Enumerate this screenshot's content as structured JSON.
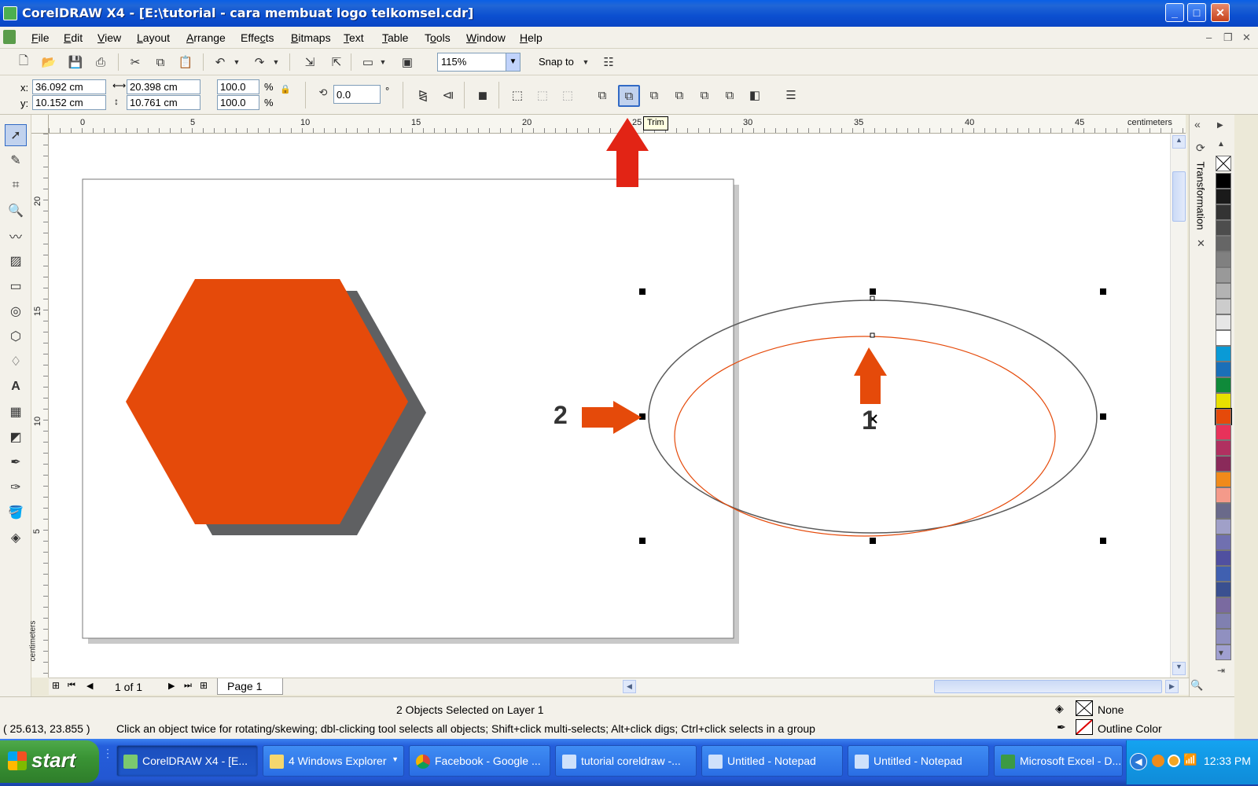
{
  "window": {
    "title": "CorelDRAW X4 - [E:\\tutorial - cara membuat logo telkomsel.cdr]",
    "btn_minimize": "_",
    "btn_maximize": "□",
    "btn_close": "✕"
  },
  "menu": [
    "File",
    "Edit",
    "View",
    "Layout",
    "Arrange",
    "Effects",
    "Bitmaps",
    "Text",
    "Table",
    "Tools",
    "Window",
    "Help"
  ],
  "menu_accel": [
    "F",
    "E",
    "V",
    "L",
    "A",
    "c",
    "B",
    "T",
    "T",
    "o",
    "W",
    "H"
  ],
  "toolbar": {
    "zoom": "115%",
    "snap_to": "Snap to"
  },
  "property_bar": {
    "x_label": "x:",
    "y_label": "y:",
    "x_value": "36.092 cm",
    "y_value": "10.152 cm",
    "width": "20.398 cm",
    "height": "10.761 cm",
    "scale_w": "100.0",
    "scale_h": "100.0",
    "percent": "%",
    "rotation": "0.0",
    "degree": "°",
    "tooltip": "Trim"
  },
  "rulers": {
    "h_ticks": [
      "0",
      "5",
      "10",
      "15",
      "20",
      "25",
      "30",
      "35",
      "40",
      "45"
    ],
    "v_ticks": [
      "20",
      "15",
      "10",
      "5"
    ],
    "units": "centimeters"
  },
  "canvas": {
    "label_one": "1",
    "label_two": "2",
    "fill_orange": "#e54a0a",
    "shadow_gray": "#5f6062",
    "arrow_red": "#e22415"
  },
  "docker": {
    "tab": "Transformation",
    "close": "✕"
  },
  "palette": [
    "#000000",
    "#1a1a1a",
    "#333333",
    "#4d4d4d",
    "#666666",
    "#808080",
    "#999999",
    "#b3b3b3",
    "#cccccc",
    "#e6e6e6",
    "#ffffff",
    "#0a9ad6",
    "#1a6fb8",
    "#0f8a3a",
    "#e8e000",
    "#e54a0a",
    "#e8325a",
    "#b03060",
    "#8a2a5a",
    "#f08a1a",
    "#f49a8a",
    "#6a6a8a",
    "#a0a0c8",
    "#7070b0",
    "#5050a0",
    "#4060b0",
    "#3a5090",
    "#7a6aa0",
    "#8080b0",
    "#9090c0",
    "#a0a0d0"
  ],
  "pagenav": {
    "counter": "1 of 1",
    "page_tab": "Page 1"
  },
  "status": {
    "selection": "2 Objects Selected on Layer 1",
    "coords": "( 25.613, 23.855 )",
    "hint": "Click an object twice for rotating/skewing; dbl-clicking tool selects all objects; Shift+click multi-selects; Alt+click digs; Ctrl+click selects in a group",
    "fill": "None",
    "outline": "Outline Color"
  },
  "taskbar": {
    "start": "start",
    "tasks": [
      "CorelDRAW X4 - [E...",
      "4 Windows Explorer",
      "Facebook - Google ...",
      "tutorial coreldraw -...",
      "Untitled - Notepad",
      "Untitled - Notepad",
      "Microsoft Excel - D..."
    ],
    "clock": "12:33 PM"
  }
}
